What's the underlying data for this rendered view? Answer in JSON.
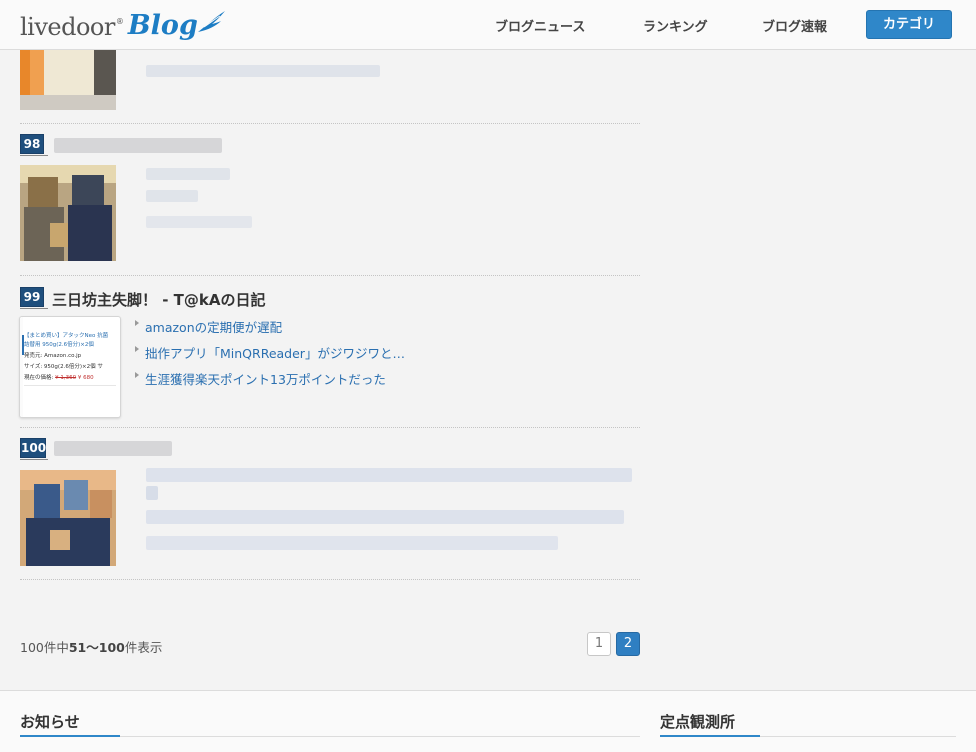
{
  "header": {
    "logo_text": "livedoor",
    "logo_registered": "®",
    "logo_blog": "Blog",
    "nav": [
      "ブログニュース",
      "ランキング",
      "ブログ速報"
    ],
    "category_button": "カテゴリ"
  },
  "ranking": {
    "entries": [
      {
        "rank": "98"
      },
      {
        "rank": "99",
        "title": "三日坊主失脚！ - T@kAの日記",
        "posts": [
          "amazonの定期便が遅配",
          "拙作アプリ「MinQRReader」がジワジワと…",
          "生涯獲得楽天ポイント13万ポイントだった"
        ],
        "amazon_card": {
          "line1": "【まとめ買い】アタックNeo 抗菌",
          "line2": "詰替用 950g(2.6倍分)×2個",
          "publisher": "発売元: Amazon.co.jp",
          "size": "サイズ: 950g(2.6倍分)×2個 サ",
          "price_label": "現在の価格:",
          "price_list": "¥ 1,360",
          "price_sale": "¥ 680"
        }
      },
      {
        "rank": "100"
      }
    ]
  },
  "pagination": {
    "count_prefix": "100件中",
    "count_range": "51〜100",
    "count_suffix": "件表示",
    "pages": [
      "1",
      "2"
    ],
    "current_page": "2"
  },
  "footer": {
    "news_title": "お知らせ",
    "observatory_title": "定点観測所"
  },
  "colors": {
    "accent": "#2f87c9",
    "link": "#2a6fb0",
    "rank_badge": "#1f4f7d"
  }
}
